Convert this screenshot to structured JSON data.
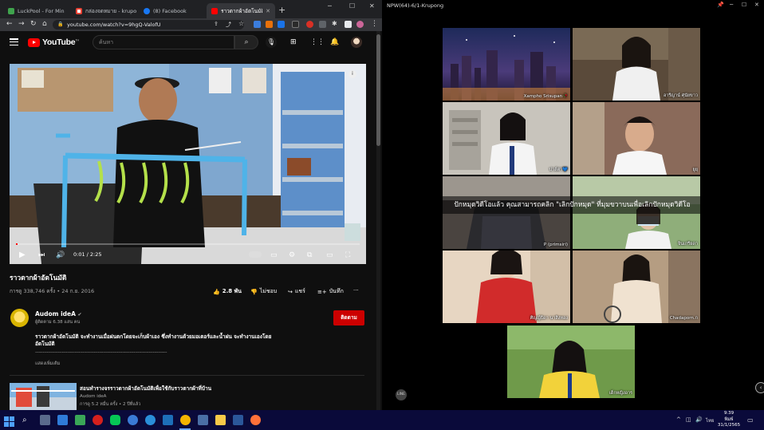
{
  "browser": {
    "tabs": [
      {
        "label": "LuckPool - For Min",
        "color": "#3fa34d"
      },
      {
        "label": "กล่องจดหมาย - krupo",
        "color": "#ea4335"
      },
      {
        "label": "(8) Facebook",
        "color": "#1877f2"
      },
      {
        "label": "ราวตากผ้าอัตโนมัติ - Yo",
        "color": "#ff0000"
      }
    ],
    "url": "youtube.com/watch?v=9hgQ-ValofU"
  },
  "youtube": {
    "logo_text": "YouTube",
    "logo_sup": "TH",
    "search_placeholder": "ค้นหา",
    "video": {
      "title": "ราวตากผ้าอัตโนมัติ",
      "time": "0:01 / 2:25",
      "views_date": "การดู 338,746 ครั้ง • 24 ก.ย. 2016",
      "likes": "2.8 พัน",
      "dislike": "ไม่ชอบ",
      "share": "แชร์",
      "save": "บันทึก"
    },
    "channel": {
      "name": "Audom ideA",
      "subs": "ผู้ติดตาม 6.38 แสน คน",
      "subscribe": "ติดตาม"
    },
    "description": "ราวตากผ้าอัตโนมัติ จะทำงานเมื่อฝนตกโดยจะเก็บผ้าเอง ซึ่งทำงานด้วยมอเตอร์และน้ำฝน จะทำงานเองโดยอัตโนมัติ",
    "dashes": "-------------------------------------------------------------------------------------------------------",
    "show_more": "แสดงเพิ่มเติม",
    "recommended": {
      "title": "สอนทำรางจรราวตากผ้าอัตโนมัติเพื่อใช้กับราวตากผ้าที่บ้าน",
      "channel": "Audom ideA",
      "meta": "การดู 5.2 หมื่น ครั้ง • 2 ปีที่แล้ว"
    }
  },
  "meeting": {
    "title": "NPW(64)-6/1-Krupong",
    "banner": "ปักหมุดวิดีโอแล้ว คุณสามารถคลิก \"เลิกปักหมุด\" ที่มุมขวาบนเพื่อเลิกปักหมุดวิดีโอ",
    "participants": [
      {
        "name": "Xampho Srisupan🥀"
      },
      {
        "name": "อารีญาน์ ศุนัยขาว"
      },
      {
        "name": "ปาล์ต่า💙"
      },
      {
        "name": "ยูยุ"
      },
      {
        "name": "P (primsiri)"
      },
      {
        "name": "จินเกรียดา"
      },
      {
        "name": "ศิญญ์ธิดา นาสิงทอง"
      },
      {
        "name": "Chadaporn.ก"
      },
      {
        "name": "เด็กหญิงอาร"
      }
    ],
    "line_label": "LINE"
  },
  "taskbar": {
    "lang": "ไทย",
    "time": "9:39",
    "day": "พิมพ์",
    "date": "31/1/2565"
  }
}
